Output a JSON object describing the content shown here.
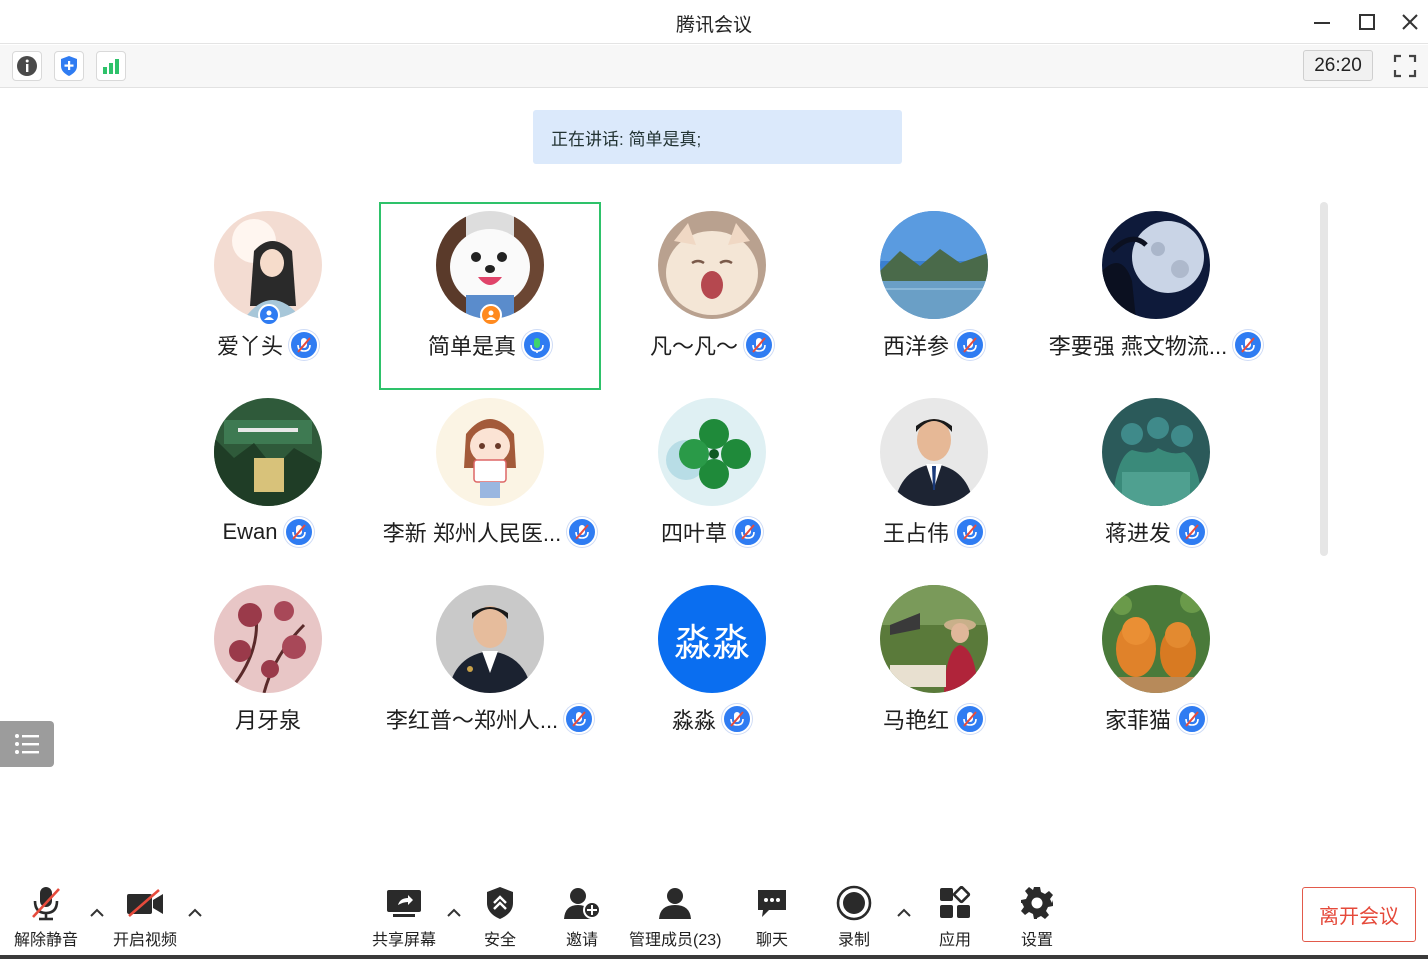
{
  "window": {
    "title": "腾讯会议"
  },
  "toolbar": {
    "timer": "26:20"
  },
  "speaking": {
    "text": "正在讲话: 简单是真;"
  },
  "participants": [
    {
      "name": "爱丫头",
      "mic": "muted",
      "badge": "host"
    },
    {
      "name": "简单是真",
      "mic": "talking",
      "badge": "cohost",
      "active": true
    },
    {
      "name": "凡～凡～",
      "mic": "muted"
    },
    {
      "name": "西洋参",
      "mic": "muted"
    },
    {
      "name": "李要强 燕文物流...",
      "mic": "muted"
    },
    {
      "name": "Ewan",
      "mic": "muted"
    },
    {
      "name": "李新 郑州人民医...",
      "mic": "muted"
    },
    {
      "name": "四叶草",
      "mic": "muted"
    },
    {
      "name": "王占伟",
      "mic": "muted"
    },
    {
      "name": "蒋进发",
      "mic": "muted"
    },
    {
      "name": "月牙泉",
      "mic": "none"
    },
    {
      "name": "李红普～郑州人...",
      "mic": "muted"
    },
    {
      "name": "淼淼",
      "mic": "muted",
      "avatar_text": "淼淼"
    },
    {
      "name": "马艳红",
      "mic": "muted"
    },
    {
      "name": "家菲猫",
      "mic": "muted"
    }
  ],
  "bottom": {
    "unmute": "解除静音",
    "start_video": "开启视频",
    "share_screen": "共享屏幕",
    "security": "安全",
    "invite": "邀请",
    "manage_members": "管理成员(23)",
    "chat": "聊天",
    "record": "录制",
    "apps": "应用",
    "settings": "设置",
    "leave": "离开会议"
  },
  "colors": {
    "accent": "#2f7cf2",
    "active_border": "#2ec26a",
    "leave": "#e5493a",
    "banner": "#dbe9fb"
  }
}
